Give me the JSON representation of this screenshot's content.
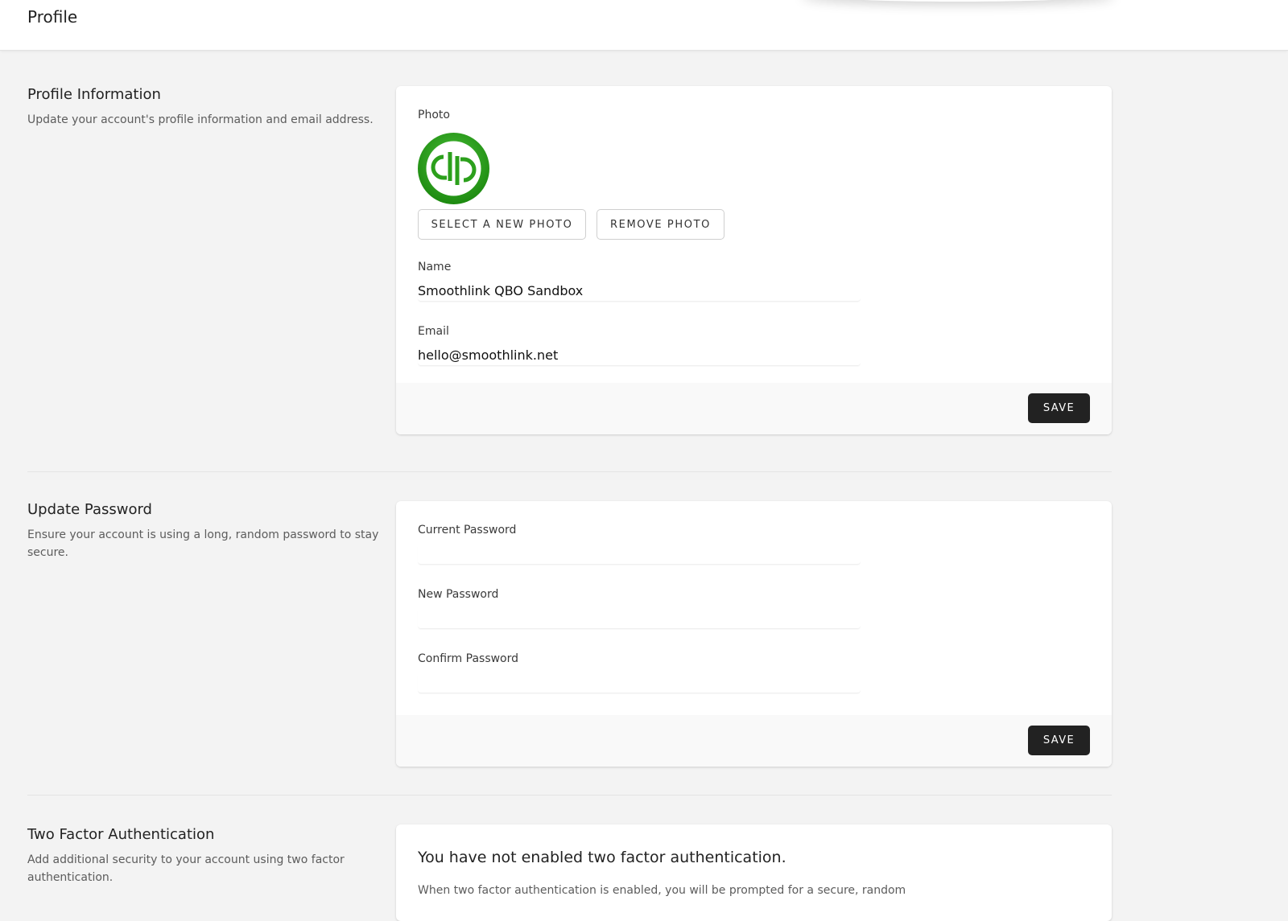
{
  "page": {
    "title": "Profile"
  },
  "profile_info": {
    "heading": "Profile Information",
    "description": "Update your account's profile information and email address.",
    "photo_label": "Photo",
    "avatar_text": "qb",
    "select_photo_label": "SELECT A NEW PHOTO",
    "remove_photo_label": "REMOVE PHOTO",
    "name_label": "Name",
    "name_value": "Smoothlink QBO Sandbox",
    "email_label": "Email",
    "email_value": "hello@smoothlink.net",
    "save_label": "SAVE"
  },
  "update_password": {
    "heading": "Update Password",
    "description": "Ensure your account is using a long, random password to stay secure.",
    "current_label": "Current Password",
    "new_label": "New Password",
    "confirm_label": "Confirm Password",
    "save_label": "SAVE"
  },
  "two_factor": {
    "heading": "Two Factor Authentication",
    "description": "Add additional security to your account using two factor authentication.",
    "status_title": "You have not enabled two factor authentication.",
    "status_text": "When two factor authentication is enabled, you will be prompted for a secure, random"
  },
  "colors": {
    "background": "#f3f3f3",
    "card": "#ffffff",
    "primary_button": "#222222",
    "avatar_green": "#2ca01c"
  }
}
